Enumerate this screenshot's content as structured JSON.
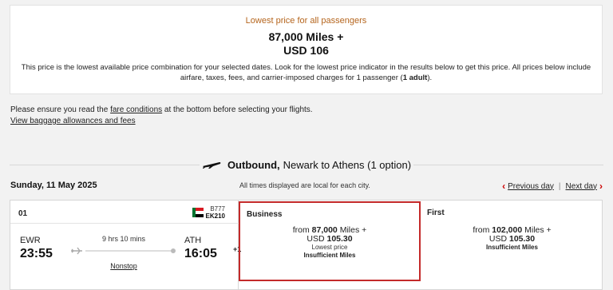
{
  "summary": {
    "label": "Lowest price for all passengers",
    "miles": "87,000 Miles +",
    "usd": "USD 106",
    "desc_part1": "This price is the lowest available price combination for your selected dates. Look for the lowest price indicator in the results below to get this price. All prices below include airfare, taxes, fees, and carrier-imposed charges for 1 passenger (",
    "desc_bold": "1 adult",
    "desc_part2": ")."
  },
  "notice": {
    "prefix": "Please ensure you read the ",
    "link": "fare conditions",
    "suffix": " at the bottom before selecting your flights.",
    "baggage_link": "View baggage allowances and fees"
  },
  "outbound": {
    "title": "Outbound,",
    "route": "Newark to Athens (1 option)"
  },
  "date_row": {
    "date": "Sunday, 11 May 2025",
    "timezone_note": "All times displayed are local for each city.",
    "prev_day": "Previous day",
    "next_day": "Next day"
  },
  "flight": {
    "number": "01",
    "aircraft": "B777",
    "flight_code": "EK210",
    "origin": "EWR",
    "departure": "23:55",
    "destination": "ATH",
    "arrival": "16:05",
    "day_offset": "+1",
    "duration": "9 hrs 10 mins",
    "stops": "Nonstop"
  },
  "fares": {
    "business": {
      "title": "Business",
      "from": "from",
      "miles": "87,000",
      "miles_suffix": "Miles +",
      "usd_prefix": "USD",
      "usd": "105.30",
      "note": "Lowest price",
      "status": "Insufficient Miles"
    },
    "first": {
      "title": "First",
      "from": "from",
      "miles": "102,000",
      "miles_suffix": "Miles +",
      "usd_prefix": "USD",
      "usd": "105.30",
      "status": "Insufficient Miles"
    }
  },
  "colors": {
    "accent_red": "#c42a2a",
    "label_orange": "#b5651d"
  },
  "icons": [
    "plane-icon",
    "chevron-left-icon",
    "chevron-right-icon",
    "airline-logo-icon",
    "route-plane-icon"
  ]
}
